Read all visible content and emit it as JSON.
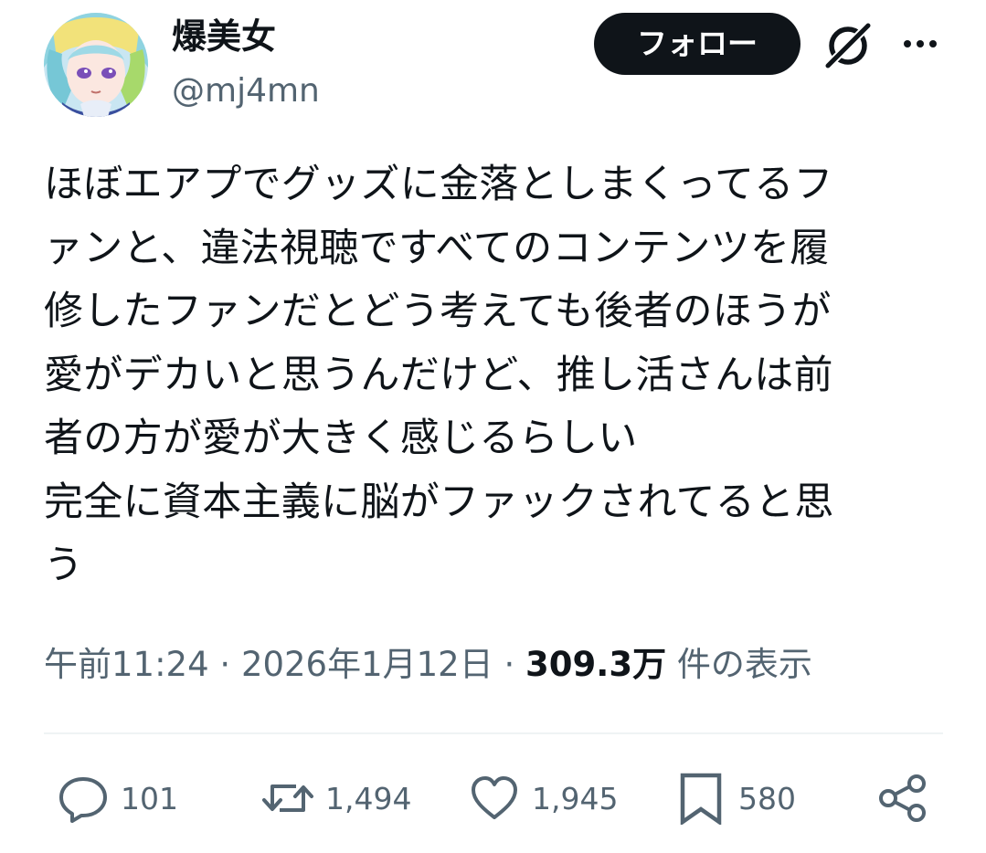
{
  "user": {
    "display_name": "爆美女",
    "handle": "@mj4mn"
  },
  "header": {
    "follow_label": "フォロー"
  },
  "tweet": {
    "lines": [
      "ほぼエアプでグッズに金落としまくってるフ",
      "ァンと、違法視聴ですべてのコンテンツを履",
      "修したファンだとどう考えても後者のほうが",
      "愛がデカいと思うんだけど、推し活さんは前",
      "者の方が愛が大きく感じるらしい",
      "完全に資本主義に脳がファックされてると思",
      "う"
    ],
    "time": "午前11:24",
    "separator": "·",
    "date": "2026年1月12日",
    "views_count": "309.3万",
    "views_label": "件の表示"
  },
  "actions": {
    "reply_count": "101",
    "repost_count": "1,494",
    "like_count": "1,945",
    "bookmark_count": "580"
  },
  "icons": [
    "avatar-image",
    "grok-icon",
    "more-icon",
    "reply-icon",
    "repost-icon",
    "like-icon",
    "bookmark-icon",
    "share-icon"
  ],
  "colors": {
    "text": "#0f1419",
    "secondary_text": "#536471",
    "follow_button_bg": "#0f1419",
    "divider": "#eff3f4"
  }
}
